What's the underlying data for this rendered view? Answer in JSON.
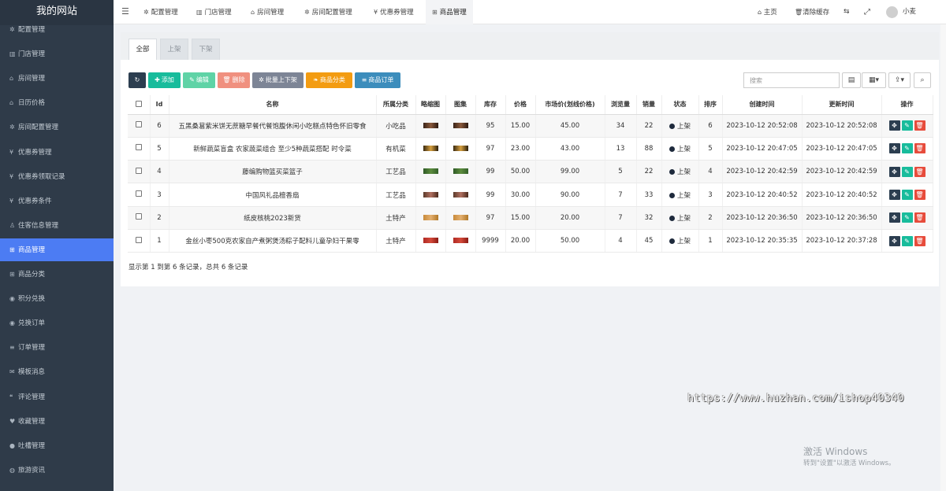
{
  "app": {
    "title": "我的网站"
  },
  "sidebar": {
    "items": [
      {
        "label": "配置管理",
        "icon": "gear-icon"
      },
      {
        "label": "门店管理",
        "icon": "bank-icon"
      },
      {
        "label": "房间管理",
        "icon": "home-icon"
      },
      {
        "label": "日历价格",
        "icon": "home-icon"
      },
      {
        "label": "房间配置管理",
        "icon": "gear-icon"
      },
      {
        "label": "优惠券管理",
        "icon": "yen-icon"
      },
      {
        "label": "优惠券领取记录",
        "icon": "yen-icon"
      },
      {
        "label": "优惠券条件",
        "icon": "yen-icon"
      },
      {
        "label": "住客信息管理",
        "icon": "user-icon"
      },
      {
        "label": "商品管理",
        "icon": "cart-icon",
        "active": true
      },
      {
        "label": "商品分类",
        "icon": "cart-icon"
      },
      {
        "label": "积分兑换",
        "icon": "coin-icon"
      },
      {
        "label": "兑换订单",
        "icon": "coin-icon"
      },
      {
        "label": "订单管理",
        "icon": "list-icon"
      },
      {
        "label": "模板消息",
        "icon": "mail-icon"
      },
      {
        "label": "评论管理",
        "icon": "comment-icon"
      },
      {
        "label": "收藏管理",
        "icon": "heart-icon"
      },
      {
        "label": "吐槽管理",
        "icon": "chat-icon"
      },
      {
        "label": "旅游资讯",
        "icon": "globe-icon"
      }
    ]
  },
  "topbar": {
    "tabs": [
      {
        "label": "配置管理",
        "icon": "gear-icon"
      },
      {
        "label": "门店管理",
        "icon": "bank-icon"
      },
      {
        "label": "房间管理",
        "icon": "home-icon"
      },
      {
        "label": "房间配置管理",
        "icon": "gear-icon"
      },
      {
        "label": "优惠券管理",
        "icon": "yen-icon"
      },
      {
        "label": "商品管理",
        "icon": "cart-icon",
        "active": true
      }
    ],
    "home": "主页",
    "clear_cache": "清除缓存",
    "user": "小麦"
  },
  "filter_tabs": [
    "全部",
    "上架",
    "下架"
  ],
  "toolbar": {
    "add": "添加",
    "edit": "编辑",
    "delete": "删除",
    "batch": "批量上下架",
    "category": "商品分类",
    "orders": "商品订单",
    "search_placeholder": "搜索"
  },
  "table": {
    "columns": [
      "Id",
      "名称",
      "所属分类",
      "略缩图",
      "图集",
      "库存",
      "价格",
      "市场价(划线价格)",
      "浏览量",
      "销量",
      "状态",
      "排序",
      "创建时间",
      "更新时间",
      "操作"
    ],
    "rows": [
      {
        "id": "6",
        "name": "五黑桑葚紫米饼无蔗糖早餐代餐饱腹休闲小吃糕点特色怀旧零食",
        "category": "小吃品",
        "thumb": "dark",
        "stock": "95",
        "price": "15.00",
        "market_price": "45.00",
        "views": "34",
        "sales": "22",
        "status": "上架",
        "sort": "6",
        "created": "2023-10-12 20:52:08",
        "updated": "2023-10-12 20:52:08"
      },
      {
        "id": "5",
        "name": "新鲜蔬菜盲盒 农家蔬菜组合 至少5种蔬菜搭配 时令菜",
        "category": "有机菜",
        "thumb": "amber",
        "stock": "97",
        "price": "23.00",
        "market_price": "43.00",
        "views": "13",
        "sales": "88",
        "status": "上架",
        "sort": "5",
        "created": "2023-10-12 20:47:05",
        "updated": "2023-10-12 20:47:05"
      },
      {
        "id": "4",
        "name": "藤编购物篮买菜篮子",
        "category": "工艺品",
        "thumb": "green",
        "stock": "99",
        "price": "50.00",
        "market_price": "99.00",
        "views": "5",
        "sales": "22",
        "status": "上架",
        "sort": "4",
        "created": "2023-10-12 20:42:59",
        "updated": "2023-10-12 20:42:59"
      },
      {
        "id": "3",
        "name": "中国风礼品檀香扇",
        "category": "工艺品",
        "thumb": "brown",
        "stock": "99",
        "price": "30.00",
        "market_price": "90.00",
        "views": "7",
        "sales": "33",
        "status": "上架",
        "sort": "3",
        "created": "2023-10-12 20:40:52",
        "updated": "2023-10-12 20:40:52"
      },
      {
        "id": "2",
        "name": "纸皮核桃2023新货",
        "category": "土特产",
        "thumb": "nut",
        "stock": "97",
        "price": "15.00",
        "market_price": "20.00",
        "views": "7",
        "sales": "32",
        "status": "上架",
        "sort": "2",
        "created": "2023-10-12 20:36:50",
        "updated": "2023-10-12 20:36:50"
      },
      {
        "id": "1",
        "name": "金丝小枣500克农家自产煮粥煲汤粽子配料儿童孕妇干果零",
        "category": "土特产",
        "thumb": "red",
        "stock": "9999",
        "price": "20.00",
        "market_price": "50.00",
        "views": "4",
        "sales": "45",
        "status": "上架",
        "sort": "1",
        "created": "2023-10-12 20:35:35",
        "updated": "2023-10-12 20:37:28"
      }
    ]
  },
  "summary": "显示第 1 到第 6 条记录，总共 6 条记录",
  "watermark": "https://www.huzhan.com/ishop40340",
  "activation": {
    "title": "激活 Windows",
    "subtitle": "转到\"设置\"以激活 Windows。"
  },
  "colors": {
    "sidebar_bg": "#2f3b49",
    "active_nav": "#4c7cf3",
    "add_btn": "#18bc9c",
    "edit_btn": "#5fd3a6",
    "delete_btn": "#f0907f",
    "batch_btn": "#7d8596",
    "category_btn": "#f39c12",
    "orders_btn": "#3c8dbc"
  }
}
